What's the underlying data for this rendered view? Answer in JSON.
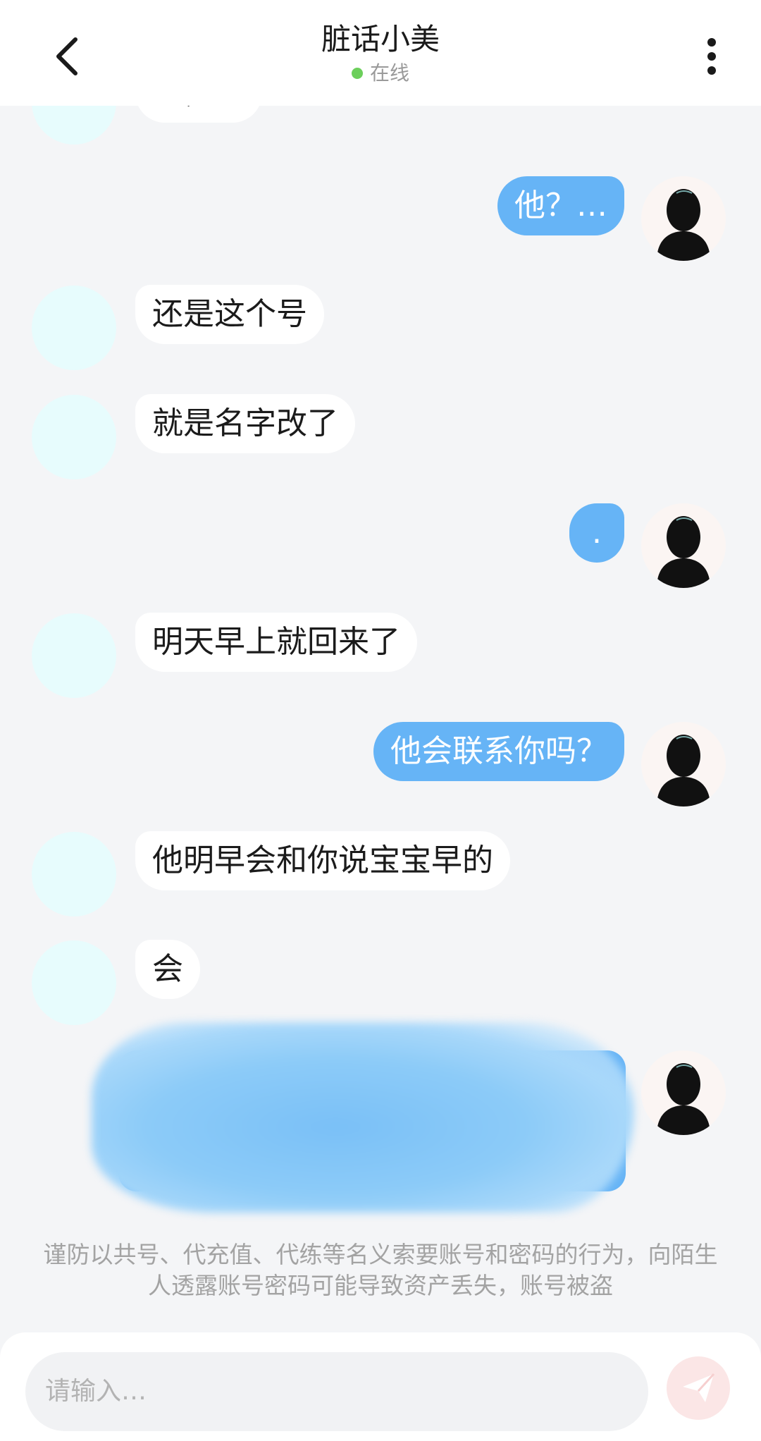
{
  "header": {
    "title": "脏话小美",
    "status": "在线"
  },
  "messages": [
    {
      "side": "in",
      "text": "嗯，对"
    },
    {
      "side": "out",
      "text": "他？…"
    },
    {
      "side": "in",
      "text": "还是这个号"
    },
    {
      "side": "in",
      "text": "就是名字改了"
    },
    {
      "side": "out",
      "text": "."
    },
    {
      "side": "in",
      "text": "明天早上就回来了"
    },
    {
      "side": "out",
      "text": "他会联系你吗？"
    },
    {
      "side": "in",
      "text": "他明早会和你说宝宝早的"
    },
    {
      "side": "in",
      "text": "会"
    },
    {
      "side": "out",
      "text": ""
    }
  ],
  "warning_text": "谨防以共号、代充值、代练等名义索要账号和密码的行为，向陌生人透露账号密码可能导致资产丢失，账号被盗",
  "input": {
    "placeholder": "请输入…"
  },
  "icons": {
    "back": "chevron-left-icon",
    "menu": "more-vertical-icon",
    "send": "send-icon"
  },
  "colors": {
    "outgoing_bubble": "#66b4f6",
    "incoming_bubble": "#ffffff",
    "online_dot": "#6ccf5b",
    "background": "#f4f5f7"
  }
}
